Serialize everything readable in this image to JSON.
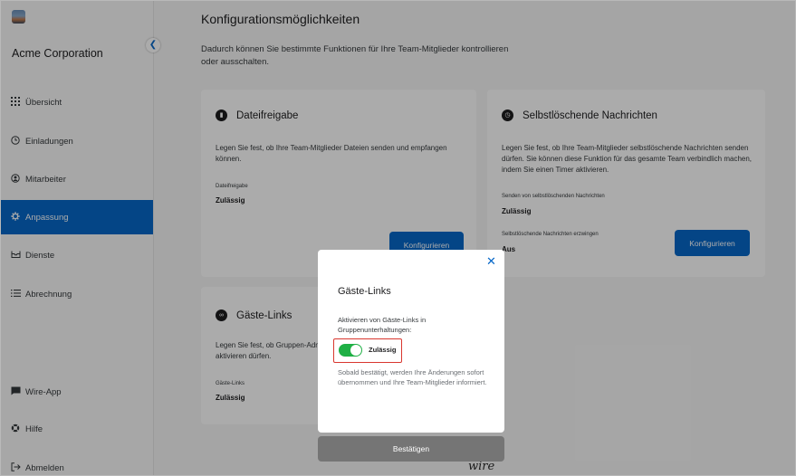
{
  "sidebar": {
    "org_name": "Acme Corporation",
    "items": [
      {
        "label": "Übersicht",
        "icon": "grid-icon"
      },
      {
        "label": "Einladungen",
        "icon": "clock-icon"
      },
      {
        "label": "Mitarbeiter",
        "icon": "user-circle-icon"
      },
      {
        "label": "Anpassung",
        "icon": "gear-icon",
        "active": true
      },
      {
        "label": "Dienste",
        "icon": "tray-icon"
      },
      {
        "label": "Abrechnung",
        "icon": "list-icon"
      },
      {
        "label": "Wire-App",
        "icon": "chat-icon"
      },
      {
        "label": "Hilfe",
        "icon": "help-icon"
      },
      {
        "label": "Abmelden",
        "icon": "logout-icon"
      }
    ]
  },
  "main": {
    "title": "Konfigurationsmöglichkeiten",
    "description": "Dadurch können Sie bestimmte Funktionen für Ihre Team-Mitglieder kontrollieren oder ausschalten.",
    "cards": {
      "file_sharing": {
        "title": "Dateifreigabe",
        "description": "Legen Sie fest, ob Ihre Team-Mitglieder Dateien senden und empfangen können.",
        "setting_label": "Dateifreigabe",
        "setting_value": "Zulässig",
        "button": "Konfigurieren"
      },
      "self_deleting": {
        "title": "Selbstlöschende Nachrichten",
        "description": "Legen Sie fest, ob Ihre Team-Mitglieder selbstlöschende Nachrichten senden dürfen. Sie können diese Funktion für das gesamte Team verbindlich machen, indem Sie einen Timer aktivieren.",
        "setting1_label": "Senden von selbstlöschenden Nachrichten",
        "setting1_value": "Zulässig",
        "setting2_label": "Selbstlöschende Nachrichten erzwingen",
        "setting2_value": "Aus",
        "button": "Konfigurieren"
      },
      "guest_links": {
        "title": "Gäste-Links",
        "description": "Legen Sie fest, ob Gruppen-Adm aktivieren dürfen.",
        "setting_label": "Gäste-Links",
        "setting_value": "Zulässig"
      }
    }
  },
  "modal": {
    "title": "Gäste-Links",
    "description": "Aktivieren von Gäste-Links in Gruppenunterhaltungen:",
    "toggle_label": "Zulässig",
    "toggle_on": true,
    "note": "Sobald bestätigt, werden Ihre Änderungen sofort übernommen und Ihre Team-Mitglieder informiert.",
    "confirm_button": "Bestätigen",
    "close_icon": "close-icon"
  },
  "footer": {
    "logo_text": "wire"
  },
  "colors": {
    "accent": "#0667c8",
    "toggle_on": "#1fb045",
    "highlight": "#d9372f",
    "confirm": "#757575"
  }
}
